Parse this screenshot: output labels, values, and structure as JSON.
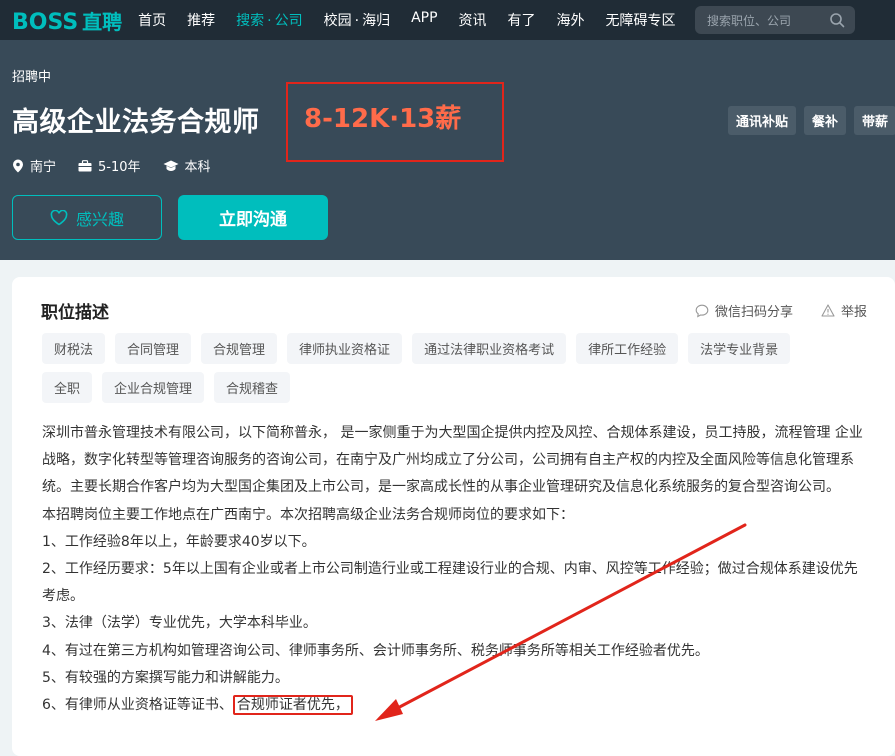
{
  "nav": {
    "logo_boss": "BOSS",
    "logo_zp": "直聘",
    "items": [
      {
        "label": "首页"
      },
      {
        "label": "推荐"
      },
      {
        "label": "搜索",
        "suffix": "公司",
        "sep": "·",
        "active": true
      },
      {
        "label": "校园",
        "suffix": "海归",
        "sep": "·"
      },
      {
        "label": "APP"
      },
      {
        "label": "资讯"
      },
      {
        "label": "有了"
      },
      {
        "label": "海外"
      },
      {
        "label": "无障碍专区"
      }
    ],
    "search_placeholder": "搜索职位、公司"
  },
  "header": {
    "status": "招聘中",
    "title": "高级企业法务合规师",
    "salary": "8-12K·13薪",
    "location": "南宁",
    "experience": "5-10年",
    "education": "本科",
    "benefits": [
      "通讯补贴",
      "餐补",
      "带薪"
    ],
    "interest_label": "感兴趣",
    "chat_label": "立即沟通"
  },
  "card": {
    "section_title": "职位描述",
    "share_label": "微信扫码分享",
    "report_label": "举报",
    "tags_row1": [
      "财税法",
      "合同管理",
      "合规管理",
      "律师执业资格证",
      "通过法律职业资格考试",
      "律所工作经验",
      "法学专业背景"
    ],
    "tags_row2": [
      "全职",
      "企业合规管理",
      "合规稽查"
    ],
    "desc_para": "深圳市普永管理技术有限公司，以下简称普永， 是一家侧重于为大型国企提供内控及风控、合规体系建设，员工持股，流程管理 企业战略，数字化转型等管理咨询服务的咨询公司，在南宁及广州均成立了分公司，公司拥有自主产权的内控及全面风险等信息化管理系统。主要长期合作客户均为大型国企集团及上市公司，是一家高成长性的从事企业管理研究及信息化系统服务的复合型咨询公司。",
    "desc_intro": "本招聘岗位主要工作地点在广西南宁。本次招聘高级企业法务合规师岗位的要求如下：",
    "req1": "1、工作经验8年以上，年龄要求40岁以下。",
    "req2": "2、工作经历要求：5年以上国有企业或者上市公司制造行业或工程建设行业的合规、内审、风控等工作经验；做过合规体系建设优先考虑。",
    "req3": "3、法律（法学）专业优先，大学本科毕业。",
    "req4": "4、有过在第三方机构如管理咨询公司、律师事务所、会计师事务所、税务师事务所等相关工作经验者优先。",
    "req5": "5、有较强的方案撰写能力和讲解能力。",
    "req6_a": "6、有律师从业资格证等证书、",
    "req6_b": "合规师证者优先，"
  },
  "colors": {
    "accent": "#00bebd",
    "salary": "#ff6b4a",
    "annotation": "#e1251b"
  }
}
